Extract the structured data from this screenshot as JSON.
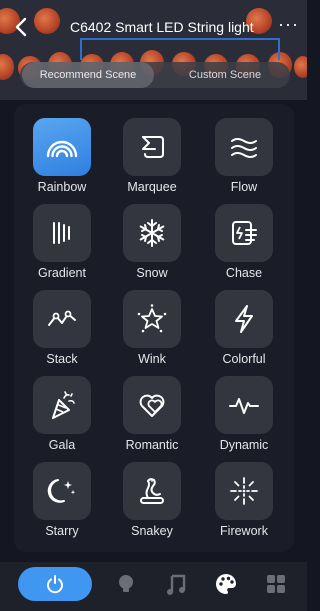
{
  "header": {
    "title": "C6402 Smart LED String light",
    "more_label": "···"
  },
  "tabs": [
    {
      "label": "Recommend Scene",
      "active": true
    },
    {
      "label": "Custom Scene",
      "active": false
    }
  ],
  "scenes": [
    {
      "label": "Rainbow",
      "icon": "rainbow-icon",
      "active": true
    },
    {
      "label": "Marquee",
      "icon": "marquee-icon"
    },
    {
      "label": "Flow",
      "icon": "flow-icon"
    },
    {
      "label": "Gradient",
      "icon": "gradient-icon"
    },
    {
      "label": "Snow",
      "icon": "snowflake-icon"
    },
    {
      "label": "Chase",
      "icon": "chase-icon"
    },
    {
      "label": "Stack",
      "icon": "stack-icon"
    },
    {
      "label": "Wink",
      "icon": "wink-icon"
    },
    {
      "label": "Colorful",
      "icon": "lightning-icon"
    },
    {
      "label": "Gala",
      "icon": "party-popper-icon"
    },
    {
      "label": "Romantic",
      "icon": "hearts-icon"
    },
    {
      "label": "Dynamic",
      "icon": "pulse-icon"
    },
    {
      "label": "Starry",
      "icon": "moon-star-icon"
    },
    {
      "label": "Snakey",
      "icon": "snake-icon"
    },
    {
      "label": "Firework",
      "icon": "firework-icon"
    }
  ],
  "bottom_nav": [
    {
      "name": "power",
      "icon": "power-icon",
      "active": true
    },
    {
      "name": "light",
      "icon": "bulb-icon"
    },
    {
      "name": "music",
      "icon": "music-icon"
    },
    {
      "name": "scene",
      "icon": "palette-icon"
    },
    {
      "name": "more",
      "icon": "grid-icon"
    }
  ],
  "colors": {
    "accent": "#3f97f2",
    "background": "#141721",
    "tile": "#34363f"
  }
}
